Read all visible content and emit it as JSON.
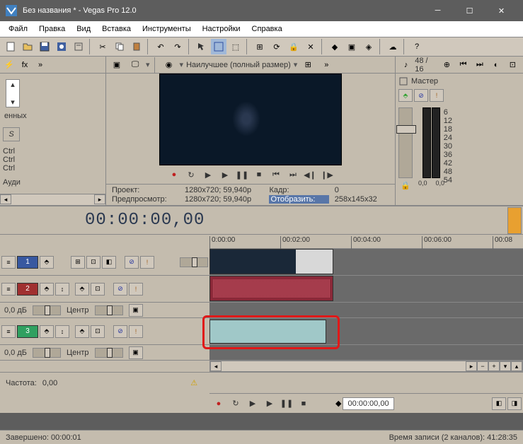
{
  "window": {
    "title": "Без названия * - Vegas Pro 12.0"
  },
  "menu": {
    "file": "Файл",
    "edit": "Правка",
    "view": "Вид",
    "insert": "Вставка",
    "tools": "Инструменты",
    "options": "Настройки",
    "help": "Справка"
  },
  "explorer": {
    "item": "енных",
    "ctrl": "Ctrl",
    "audio_tab": "Ауди"
  },
  "preview": {
    "quality": "Наилучшее (полный размер)",
    "project_lbl": "Проект:",
    "project_val": "1280x720; 59,940p",
    "preview_lbl": "Предпросмотр:",
    "preview_val": "1280x720; 59,940p",
    "frame_lbl": "Кадр:",
    "frame_val": "0",
    "display_lbl": "Отобразить:",
    "display_val": "258x145x32"
  },
  "mixer": {
    "rate": "48 / 16",
    "master": "Мастер",
    "scale": [
      "6",
      "12",
      "18",
      "24",
      "30",
      "36",
      "42",
      "48",
      "54"
    ],
    "readout": "0,0",
    "lock": "🔒"
  },
  "timeline": {
    "time": "00:00:00,00",
    "ticks": [
      "0:00:00",
      "00:02:00",
      "00:04:00",
      "00:06:00",
      "00:08"
    ]
  },
  "tracks": [
    {
      "num": "1",
      "color": "#3858a0",
      "type": "video"
    },
    {
      "num": "2",
      "color": "#a03030",
      "type": "audio",
      "db": "0,0 дБ",
      "pan": "Центр"
    },
    {
      "num": "3",
      "color": "#30a060",
      "type": "audio",
      "db": "0,0 дБ",
      "pan": "Центр"
    }
  ],
  "bottom": {
    "freq_lbl": "Частота:",
    "freq_val": "0,00",
    "time": "00:00:00,00"
  },
  "status": {
    "left": "Завершено: 00:00:01",
    "right": "Время записи (2 каналов): 41:28:35"
  }
}
